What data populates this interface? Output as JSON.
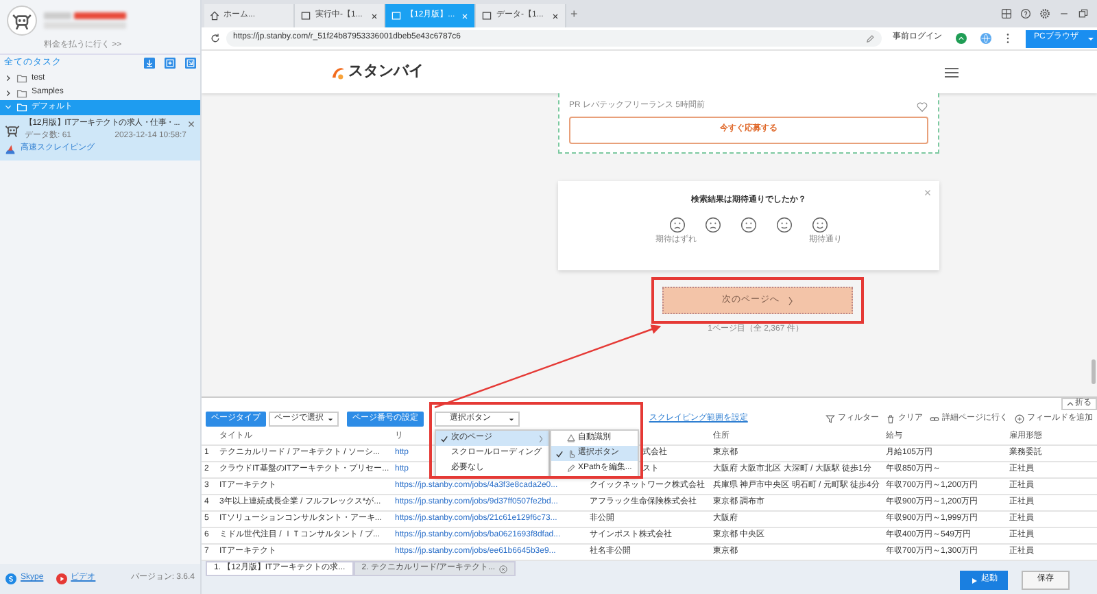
{
  "sidebar": {
    "pay_link": "料金を払うに行く >>",
    "tasks_header": "全てのタスク",
    "folders": [
      {
        "label": "test",
        "expanded": false,
        "selected": false
      },
      {
        "label": "Samples",
        "expanded": false,
        "selected": false
      },
      {
        "label": "デフォルト",
        "expanded": true,
        "selected": true,
        "tasks": [
          {
            "title": "【12月版】ITアーキテクトの求人・仕事・...",
            "count_label": "データ数:",
            "count": "61",
            "time": "2023-12-14 10:58:7",
            "mode": "高速スクレイピング"
          }
        ]
      }
    ],
    "footer": {
      "skype": "Skype",
      "video": "ビデオ",
      "version": "バージョン: 3.6.4"
    }
  },
  "browser": {
    "tabs": [
      {
        "label": "ホーム...",
        "kind": "home",
        "selected": false,
        "closable": false
      },
      {
        "label": "実行中-【1...",
        "kind": "page",
        "selected": false,
        "closable": true
      },
      {
        "label": "【12月版】...",
        "kind": "page",
        "selected": true,
        "closable": true
      },
      {
        "label": "データ-【1...",
        "kind": "page",
        "selected": false,
        "closable": true
      }
    ],
    "new_tab": "+",
    "url": "https://jp.stanby.com/r_51f24b87953336001dbeb5e43c6787c6",
    "pre_login": "事前ログイン",
    "mode_button": "PCブラウザ"
  },
  "web_page": {
    "logo": "スタンバイ",
    "job": {
      "source": "PR レバテックフリーランス 5時間前",
      "apply": "今すぐ応募する"
    },
    "feedback": {
      "question": "検索結果は期待通りでしたか？",
      "low_label": "期待はずれ",
      "high_label": "期待通り"
    },
    "next_button": "次のページへ",
    "page_info": "1ページ目（全 2,367 件）"
  },
  "collapse": "折る",
  "toolbar": {
    "page_type": "ページタイプ",
    "page_select": "ページで選択",
    "page_number": "ページ番号の設定",
    "number_select": "選択ボタン",
    "range_link": "スクレイピング範囲を設定",
    "actions": [
      {
        "label": "フィルター",
        "kind": "filter"
      },
      {
        "label": "クリア",
        "kind": "trash"
      },
      {
        "label": "詳細ページに行く",
        "kind": "link"
      },
      {
        "label": "フィールドを追加",
        "kind": "add"
      }
    ]
  },
  "menu": {
    "items": [
      {
        "label": "次のページ",
        "checked": true,
        "selected": true,
        "submenu": true
      },
      {
        "label": "スクロールローディング",
        "checked": false,
        "selected": false,
        "submenu": false
      },
      {
        "label": "必要なし",
        "checked": false,
        "selected": false,
        "submenu": false
      }
    ],
    "submenu": [
      {
        "label": "自動識別",
        "kind": "auto",
        "checked": false,
        "selected": false
      },
      {
        "label": "選択ボタン",
        "kind": "click",
        "checked": true,
        "selected": true
      },
      {
        "label": "XPathを編集...",
        "kind": "edit",
        "checked": false,
        "selected": false
      }
    ]
  },
  "table": {
    "columns": [
      {
        "kind": "index"
      },
      {
        "kind": "text",
        "label": "タイトル"
      },
      {
        "kind": "text",
        "label": "リ"
      },
      {
        "kind": "covered"
      },
      {
        "kind": "text",
        "label": "住所"
      },
      {
        "kind": "text",
        "label": "給与"
      },
      {
        "kind": "text",
        "label": "雇用形態"
      }
    ],
    "rows": [
      {
        "index": "1",
        "title": "テクニカルリード / アーキテクト / ソーシ...",
        "link": "http",
        "company": "式会社",
        "address": "東京都",
        "salary": "月給105万円",
        "employment": "業務委託"
      },
      {
        "index": "2",
        "title": "クラウドIT基盤のITアーキテクト・プリセー...",
        "link": "http",
        "company": "スト",
        "address": "大阪府 大阪市北区 大深町 / 大阪駅 徒歩1分",
        "salary": "年収850万円～",
        "employment": "正社員"
      },
      {
        "index": "3",
        "title": "ITアーキテクト",
        "link": "https://jp.stanby.com/jobs/4a3f3e8cada2e0...",
        "company": "クイックネットワーク株式会社",
        "address": "兵庫県 神戸市中央区 明石町 / 元町駅 徒歩4分",
        "salary": "年収700万円～1,200万円",
        "employment": "正社員"
      },
      {
        "index": "4",
        "title": "3年以上連続成長企業 / フルフレックス*が...",
        "link": "https://jp.stanby.com/jobs/9d37ff0507fe2bd...",
        "company": "アフラック生命保険株式会社",
        "address": "東京都 調布市",
        "salary": "年収900万円～1,200万円",
        "employment": "正社員"
      },
      {
        "index": "5",
        "title": "ITソリューションコンサルタント・アーキ...",
        "link": "https://jp.stanby.com/jobs/21c61e129f6c73...",
        "company": "非公開",
        "address": "大阪府",
        "salary": "年収900万円～1,999万円",
        "employment": "正社員"
      },
      {
        "index": "6",
        "title": "ミドル世代注目 / ＩＴコンサルタント / プ...",
        "link": "https://jp.stanby.com/jobs/ba0621693f8dfad...",
        "company": "サインポスト株式会社",
        "address": "東京都 中央区",
        "salary": "年収400万円～549万円",
        "employment": "正社員"
      },
      {
        "index": "7",
        "title": "ITアーキテクト",
        "link": "https://jp.stanby.com/jobs/ee61b6645b3e9...",
        "company": "社名非公開",
        "address": "東京都",
        "salary": "年収700万円～1,300万円",
        "employment": "正社員"
      }
    ]
  },
  "bottom": {
    "tabs": [
      {
        "label": "1. 【12月版】ITアーキテクトの求...",
        "selected": true,
        "closable": false
      },
      {
        "label": "2. テクニカルリード/アーキテクト...",
        "selected": false,
        "closable": true
      }
    ],
    "run_button": "起動",
    "save_button": "保存"
  }
}
